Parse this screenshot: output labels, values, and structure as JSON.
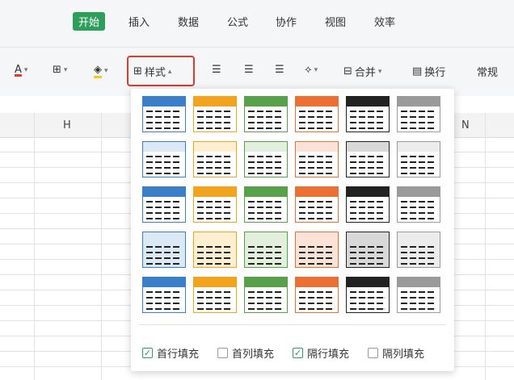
{
  "tabs": [
    {
      "label": "开始",
      "active": true
    },
    {
      "label": "插入",
      "active": false
    },
    {
      "label": "数据",
      "active": false
    },
    {
      "label": "公式",
      "active": false
    },
    {
      "label": "协作",
      "active": false
    },
    {
      "label": "视图",
      "active": false
    },
    {
      "label": "效率",
      "active": false
    }
  ],
  "toolbar": {
    "font_color_glyph": "A",
    "style_label": "样式",
    "merge_label": "合并",
    "wrap_label": "换行",
    "format_label": "常规"
  },
  "columns": {
    "h": "H",
    "n": "N"
  },
  "popup": {
    "options": [
      {
        "label": "首行填充",
        "checked": true
      },
      {
        "label": "首列填充",
        "checked": false
      },
      {
        "label": "隔行填充",
        "checked": true
      },
      {
        "label": "隔列填充",
        "checked": false
      }
    ]
  },
  "styles": {
    "accent_colors": [
      "#3a7fc7",
      "#f3a41e",
      "#59a04a",
      "#ec6f33",
      "#222222",
      "#9a9a9a"
    ]
  }
}
